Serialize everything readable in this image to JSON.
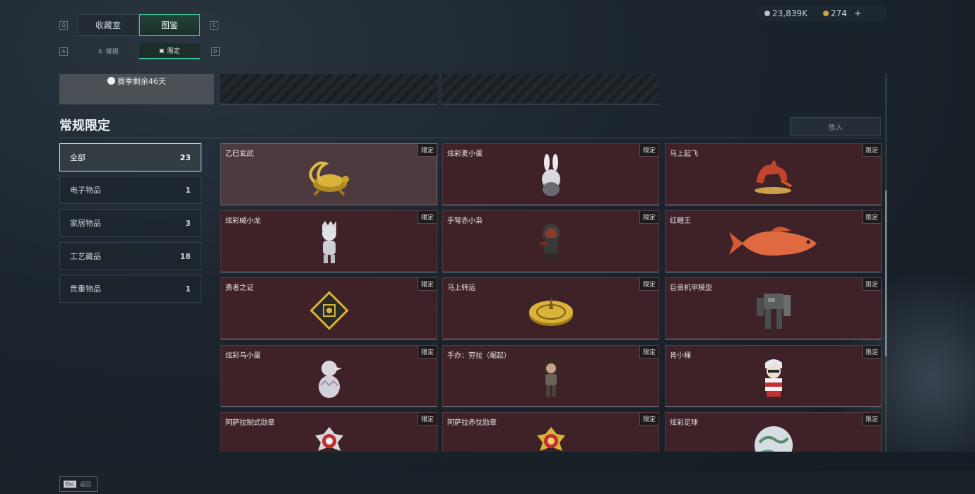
{
  "currency": {
    "silver_value": "23,839K",
    "gold_value": "274",
    "add_label": "+"
  },
  "main_tabs": {
    "left_key": "Q",
    "right_key": "E",
    "items": [
      {
        "label": "收藏室"
      },
      {
        "label": "图鉴"
      }
    ]
  },
  "sub_tabs": {
    "left_key": "A",
    "right_key": "D",
    "items": [
      {
        "icon": "anchor-icon",
        "label": "常规"
      },
      {
        "icon": "limited-icon",
        "label": "限定"
      }
    ]
  },
  "season": {
    "remaining": "赛季剩余46天"
  },
  "section": {
    "title": "常规限定",
    "sort_button": "放入"
  },
  "categories": [
    {
      "label": "全部",
      "count": "23"
    },
    {
      "label": "电子物品",
      "count": "1"
    },
    {
      "label": "家居物品",
      "count": "3"
    },
    {
      "label": "工艺藏品",
      "count": "18"
    },
    {
      "label": "贵重物品",
      "count": "1"
    }
  ],
  "badge_label": "限定",
  "items": [
    {
      "name": "乙巳玄武",
      "icon": "golden-tortoise-icon"
    },
    {
      "name": "炫彩麦小蛋",
      "icon": "rabbit-egg-icon"
    },
    {
      "name": "马上起飞",
      "icon": "red-horse-icon"
    },
    {
      "name": "炫彩威小龙",
      "icon": "dragon-figure-icon"
    },
    {
      "name": "手弩赤小枭",
      "icon": "hooded-figure-icon"
    },
    {
      "name": "红鲤王",
      "icon": "red-carp-icon"
    },
    {
      "name": "勇者之证",
      "icon": "golden-card-icon"
    },
    {
      "name": "马上转运",
      "icon": "golden-wheel-icon"
    },
    {
      "name": "巨兽机甲模型",
      "icon": "mech-model-icon"
    },
    {
      "name": "炫彩乌小蛋",
      "icon": "bird-egg-icon"
    },
    {
      "name": "手办：劳拉（崛起）",
      "icon": "lara-figure-icon"
    },
    {
      "name": "肯小桶",
      "icon": "bucket-figure-icon"
    },
    {
      "name": "阿萨拉制式勋章",
      "icon": "red-medal-icon"
    },
    {
      "name": "阿萨拉赤忱勋章",
      "icon": "gold-medal-icon"
    },
    {
      "name": "炫彩足球",
      "icon": "football-icon"
    }
  ],
  "footer": {
    "esc_key": "Esc",
    "back_label": "返回"
  }
}
